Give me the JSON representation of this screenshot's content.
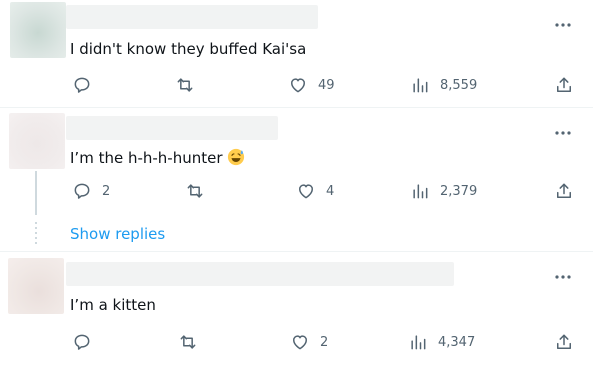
{
  "posts": [
    {
      "text": "I didn't know they buffed Kai'sa",
      "reply_count": "",
      "like_count": "49",
      "view_count": "8,559"
    },
    {
      "text": "I’m the h-h-h-hunter",
      "reply_count": "2",
      "like_count": "4",
      "view_count": "2,379"
    },
    {
      "text": "I’m a kitten",
      "reply_count": "",
      "like_count": "2",
      "view_count": "4,347"
    }
  ],
  "show_replies_label": "Show replies",
  "icons": {
    "reply": "reply-icon",
    "retweet": "retweet-icon",
    "like": "heart-icon",
    "views": "analytics-icon",
    "share": "share-icon",
    "more": "more-options-icon",
    "emoji": "grinning-sweat-emoji"
  },
  "colors": {
    "text": "#0f1419",
    "muted": "#536471",
    "link": "#1d9bf0",
    "divider": "#eff3f4",
    "thread": "#cfd9de"
  }
}
